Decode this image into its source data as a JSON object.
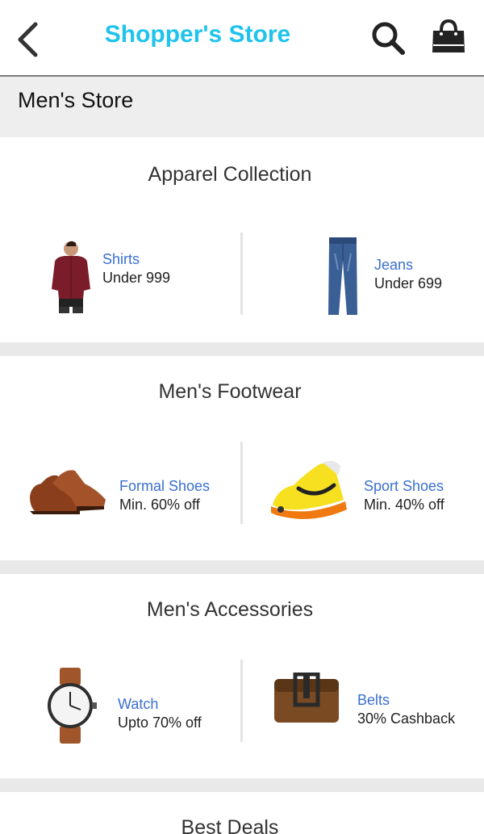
{
  "header": {
    "title": "Shopper's Store"
  },
  "store": {
    "title": "Men's Store"
  },
  "sections": [
    {
      "title": "Apparel Collection",
      "items": [
        {
          "label": "Shirts",
          "sub": "Under 999"
        },
        {
          "label": "Jeans",
          "sub": "Under 699"
        }
      ]
    },
    {
      "title": "Men's Footwear",
      "items": [
        {
          "label": "Formal Shoes",
          "sub": "Min. 60% off"
        },
        {
          "label": "Sport Shoes",
          "sub": "Min. 40% off"
        }
      ]
    },
    {
      "title": "Men's Accessories",
      "items": [
        {
          "label": "Watch",
          "sub": "Upto 70% off"
        },
        {
          "label": "Belts",
          "sub": "30% Cashback"
        }
      ]
    },
    {
      "title": "Best Deals"
    }
  ],
  "colors": {
    "accent": "#1fc3ee",
    "link": "#3a6fd0",
    "band": "#eeeeee"
  },
  "icons": {
    "back": "chevron-left-icon",
    "search": "search-icon",
    "cart": "shopping-bag-icon"
  }
}
